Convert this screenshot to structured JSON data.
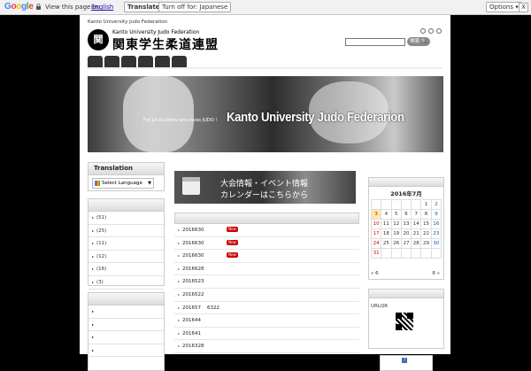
{
  "translate_bar": {
    "logo": "Google",
    "prompt": "View this page in:",
    "language": "English",
    "translate_label": "Translate",
    "turn_off_label": "Turn off for: Japanese",
    "options_label": "Options ▾",
    "close_label": "X"
  },
  "header": {
    "site_tagline": "Kanto University Judo Federation",
    "logo_en": "Kanto University Judo Federation",
    "logo_jp": "関東学生柔道連盟",
    "search_button": "検索 🔍"
  },
  "banner": {
    "tagline": "For all students who loves JUDO !",
    "title": "Kanto University Judo Federarion"
  },
  "translation_widget": {
    "title": "Translation",
    "select_label": "Select Language",
    "select_arrow": "▼"
  },
  "category_counts": [
    "(51)",
    "(25)",
    "(11)",
    "(12)",
    "(16)",
    "(3)"
  ],
  "event_banner": {
    "line1": "大会情報・イベント情報",
    "line2": "カレンダーはこちらから"
  },
  "news": [
    {
      "date": "2016630",
      "new": true
    },
    {
      "date": "2016630",
      "new": true
    },
    {
      "date": "2016630",
      "new": true
    },
    {
      "date": "2016628",
      "new": false
    },
    {
      "date": "2016523",
      "new": false
    },
    {
      "date": "2016522",
      "new": false
    },
    {
      "date": "201657    6322",
      "new": false
    },
    {
      "date": "201644",
      "new": false
    },
    {
      "date": "201641",
      "new": false
    },
    {
      "date": "2016328",
      "new": false
    }
  ],
  "new_badge": "New",
  "calendar": {
    "title": "2016年7月",
    "weeks": [
      [
        "",
        "",
        "",
        "",
        "",
        "1",
        "2"
      ],
      [
        "3",
        "4",
        "5",
        "6",
        "7",
        "8",
        "9"
      ],
      [
        "10",
        "11",
        "12",
        "13",
        "14",
        "15",
        "16"
      ],
      [
        "17",
        "18",
        "19",
        "20",
        "21",
        "22",
        "23"
      ],
      [
        "24",
        "25",
        "26",
        "27",
        "28",
        "29",
        "30"
      ],
      [
        "31",
        "",
        "",
        "",
        "",
        "",
        ""
      ]
    ],
    "today": "3",
    "prev": "« 6",
    "next": "8 »"
  },
  "qr": {
    "label": "URLQR"
  },
  "small_box_label": "?",
  "icons": {
    "tri": "▸",
    "logo_mark": "関"
  }
}
